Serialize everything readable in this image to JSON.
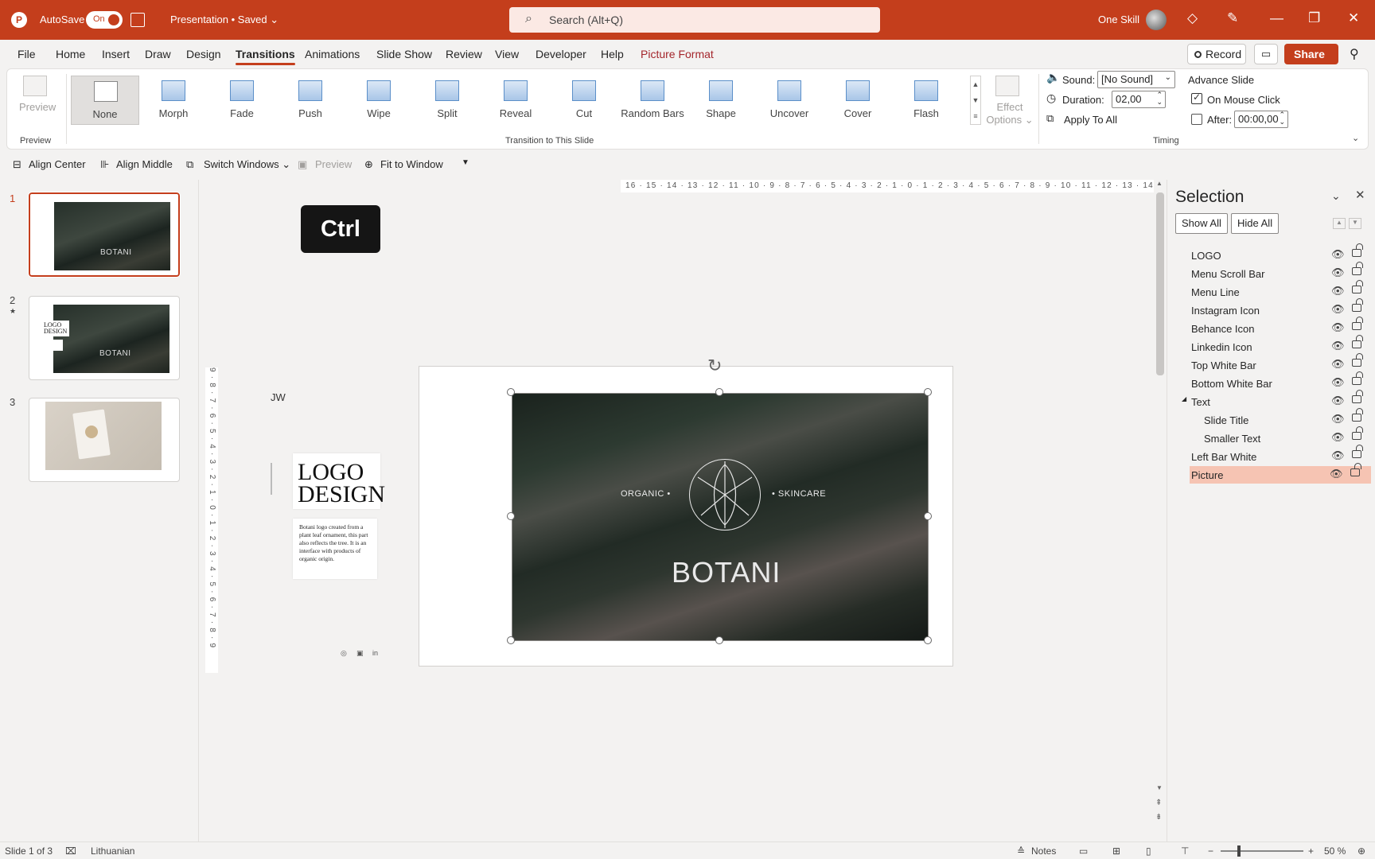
{
  "titlebar": {
    "autosave_label": "AutoSave",
    "autosave_state": "On",
    "doc_title": "Presentation • Saved ⌄",
    "search_placeholder": "Search (Alt+Q)",
    "user_name": "One Skill",
    "accent": "#c43e1c"
  },
  "menu": {
    "items": [
      "File",
      "Home",
      "Insert",
      "Draw",
      "Design",
      "Transitions",
      "Animations",
      "Slide Show",
      "Review",
      "View",
      "Developer",
      "Help",
      "Picture Format"
    ],
    "active": "Transitions",
    "record_label": "Record",
    "share_label": "Share"
  },
  "ribbon": {
    "preview_label": "Preview",
    "preview_group": "Preview",
    "transitions": [
      "None",
      "Morph",
      "Fade",
      "Push",
      "Wipe",
      "Split",
      "Reveal",
      "Cut",
      "Random Bars",
      "Shape",
      "Uncover",
      "Cover",
      "Flash"
    ],
    "selected_transition": "None",
    "effect_options": "Effect Options ⌄",
    "transition_group": "Transition to This Slide",
    "sound_label": "Sound:",
    "sound_value": "[No Sound]",
    "duration_label": "Duration:",
    "duration_value": "02,00",
    "apply_all": "Apply To All",
    "advance_label": "Advance Slide",
    "on_mouse_click": "On Mouse Click",
    "on_mouse_click_checked": true,
    "after_label": "After:",
    "after_checked": false,
    "after_value": "00:00,00",
    "timing_group": "Timing"
  },
  "quickbar": {
    "align_center": "Align Center",
    "align_middle": "Align Middle",
    "switch_windows": "Switch Windows ⌄",
    "preview": "Preview",
    "fit_to_window": "Fit to Window"
  },
  "slides": {
    "numbers": [
      "1",
      "2",
      "3"
    ],
    "thumb_brand": "BOTANI",
    "thumb_logo": "LOGO DESIGN"
  },
  "canvas": {
    "key_overlay": "Ctrl",
    "ruler_h": "16 · 15 · 14 · 13 · 12 · 11 · 10 · 9 · 8 · 7 · 6 · 5 · 4 · 3 · 2 · 1 · 0 · 1 · 2 · 3 · 4 · 5 · 6 · 7 · 8 · 9 · 10 · 11 · 12 · 13 · 14 · 15 · 16",
    "ruler_v": "9 · 8 · 7 · 6 · 5 · 4 · 3 · 2 · 1 · 0 · 1 · 2 · 3 · 4 · 5 · 6 · 7 · 8 · 9",
    "jw": "JW",
    "logo_design_l1": "LOGO",
    "logo_design_l2": "DESIGN",
    "description": "Botani logo created from a plant leaf ornament, this part also reflects the tree. It is an interface with products of organic origin.",
    "pic_left": "ORGANIC •",
    "pic_right": "• SKINCARE",
    "pic_brand": "BOTANI"
  },
  "selection_pane": {
    "title": "Selection",
    "show_all": "Show All",
    "hide_all": "Hide All",
    "items": [
      {
        "name": "LOGO",
        "indent": 0
      },
      {
        "name": "Menu Scroll Bar",
        "indent": 0
      },
      {
        "name": "Menu Line",
        "indent": 0
      },
      {
        "name": "Instagram Icon",
        "indent": 0
      },
      {
        "name": "Behance Icon",
        "indent": 0
      },
      {
        "name": "Linkedin Icon",
        "indent": 0
      },
      {
        "name": "Top White Bar",
        "indent": 0
      },
      {
        "name": "Bottom White Bar",
        "indent": 0
      },
      {
        "name": "Text",
        "indent": 0,
        "group": true
      },
      {
        "name": "Slide Title",
        "indent": 1
      },
      {
        "name": "Smaller Text",
        "indent": 1
      },
      {
        "name": "Left Bar White",
        "indent": 0
      },
      {
        "name": "Picture",
        "indent": 0,
        "selected": true
      }
    ]
  },
  "status": {
    "slide_info": "Slide 1 of 3",
    "language": "Lithuanian",
    "notes": "Notes",
    "zoom": "50 %"
  }
}
